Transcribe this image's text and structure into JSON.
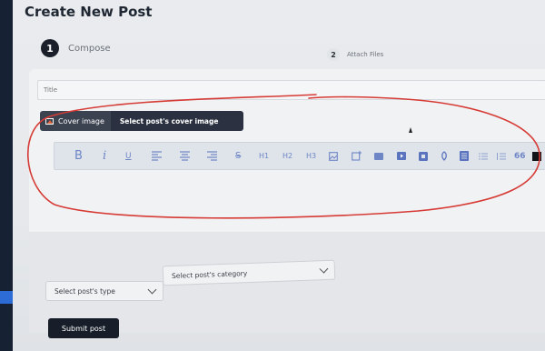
{
  "page": {
    "title": "Create New Post"
  },
  "steps": [
    {
      "number": "1",
      "label": "Compose",
      "active": true
    },
    {
      "number": "2",
      "label": "Attach Files",
      "active": false
    }
  ],
  "form": {
    "title_placeholder": "Title",
    "cover_button_label": "Cover image",
    "cover_hint": "Select post's cover image",
    "type_select_value": "Select post's type",
    "category_select_value": "Select post's category",
    "submit_label": "Submit post"
  },
  "toolbar": {
    "tools": [
      {
        "name": "bold",
        "glyph": "B"
      },
      {
        "name": "italic",
        "glyph": "i"
      },
      {
        "name": "underline",
        "glyph": "U"
      },
      {
        "name": "align-left",
        "glyph": ""
      },
      {
        "name": "align-center",
        "glyph": ""
      },
      {
        "name": "align-right",
        "glyph": ""
      },
      {
        "name": "strikethrough",
        "glyph": "S"
      },
      {
        "name": "heading-1",
        "glyph": "H1"
      },
      {
        "name": "heading-2",
        "glyph": "H2"
      },
      {
        "name": "heading-3",
        "glyph": "H3"
      },
      {
        "name": "image",
        "glyph": ""
      },
      {
        "name": "add-image",
        "glyph": ""
      },
      {
        "name": "video",
        "glyph": ""
      },
      {
        "name": "youtube",
        "glyph": ""
      },
      {
        "name": "embed",
        "glyph": ""
      },
      {
        "name": "link",
        "glyph": ""
      },
      {
        "name": "document",
        "glyph": ""
      },
      {
        "name": "bullet-list",
        "glyph": ""
      },
      {
        "name": "numbered-list",
        "glyph": ""
      },
      {
        "name": "quote",
        "glyph": "66"
      },
      {
        "name": "color",
        "glyph": ""
      }
    ]
  },
  "colors": {
    "toolbar_icon": "#6e86c6",
    "dark_button": "#171e2a",
    "annotation": "#d63b35"
  }
}
